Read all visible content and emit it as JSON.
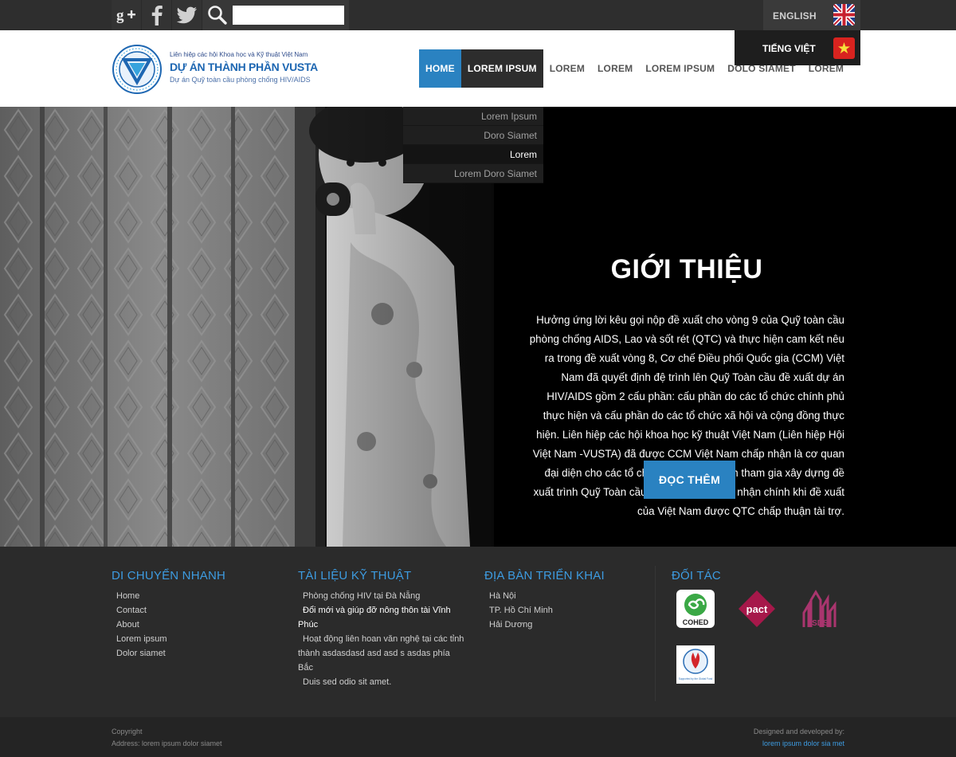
{
  "topbar": {
    "social": [
      "google-plus-icon",
      "facebook-icon",
      "twitter-icon"
    ],
    "search_icon": "search-icon",
    "search_value": "",
    "lang_en": "ENGLISH",
    "lang_vi": "TIẾNG VIỆT"
  },
  "logo": {
    "line1": "Liên hiệp các hội Khoa học và Kỹ thuật Việt Nam",
    "line2": "DỰ ÁN THÀNH PHẦN VUSTA",
    "line3": "Dự án Quỹ toàn cầu phòng chống HIV/AIDS"
  },
  "nav": {
    "items": [
      "HOME",
      "LOREM IPSUM",
      "LOREM",
      "LOREM",
      "LOREM IPSUM",
      "DOLO SIAMET",
      "LOREM"
    ]
  },
  "dropdown": {
    "items": [
      "Lorem Ipsum",
      "Doro Siamet",
      "Lorem",
      "Lorem Doro Siamet"
    ]
  },
  "hero": {
    "title": "GIỚI THIỆU",
    "text": "Hưởng ứng lời kêu gọi nộp đề xuất cho vòng 9 của Quỹ toàn cầu phòng chống AIDS, Lao và sốt rét (QTC) và thực hiện cam kết nêu ra trong đề xuất vòng 8, Cơ chế Điều phối Quốc gia (CCM) Việt Nam đã quyết định đệ trình lên Quỹ Toàn cầu đề xuất dự án HIV/AIDS gồm 2 cấu phần: cấu phần do các tổ chức chính phủ thực hiện và cấu phần do các tổ chức xã hội và cộng đồng thực hiện. Liên hiệp các hội khoa học kỹ thuật Việt Nam (Liên hiệp Hội Việt Nam -VUSTA) đã được CCM Việt Nam chấp nhận là cơ quan đại diện cho các tổ chức xã hội Việt Nam tham gia xây dựng đề xuất trình Quỹ Toàn cầu và là cơ quan tiếp nhận chính khi đề xuất của Việt Nam được QTC chấp thuận tài trợ.",
    "button": "ĐỌC THÊM"
  },
  "footer": {
    "quick_nav": {
      "title": "DI CHUYỂN NHANH",
      "links": [
        "Home",
        "Contact",
        "About",
        "Lorem ipsum",
        "Dolor siamet"
      ]
    },
    "docs": {
      "title": "TÀI LIỆU KỸ THUẬT",
      "links": [
        "Phòng chống HIV tại Đà Nẵng",
        "Đổi mới và giúp đỡ nông thôn tài Vĩnh Phúc",
        "Hoạt động liên hoan văn nghệ tại các tỉnh thành asdasdasd asd asd s asdas phía Bắc",
        "Duis sed odio sit amet."
      ]
    },
    "areas": {
      "title": "ĐỊA BÀN TRIỂN KHAI",
      "links": [
        "Hà Nội",
        "TP. Hồ Chí Minh",
        "Hải Dương"
      ]
    },
    "partners": {
      "title": "ĐỐI TÁC",
      "logos": [
        "COHED",
        "pact",
        "ISDS",
        "Supported by the Global Fund"
      ]
    }
  },
  "bottom": {
    "copyright": "Copyright",
    "address": "Address: lorem ipsum dolor siamet",
    "designed": "Designed and developed by:",
    "developer": "lorem ipsum dolor sia met"
  },
  "colors": {
    "accent": "#2a82c1",
    "footer_heading": "#3d9be0",
    "dark": "#2b2b2b"
  }
}
